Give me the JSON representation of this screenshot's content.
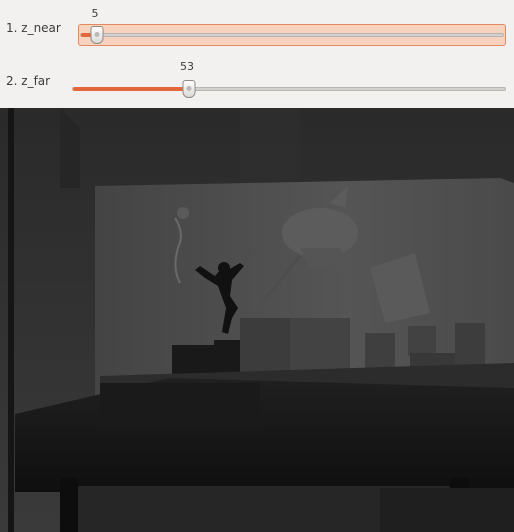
{
  "trackbars": [
    {
      "label": "1. z_near",
      "value": "5",
      "fraction": 0.04
    },
    {
      "label": "2. z_far",
      "value": "53",
      "fraction": 0.27
    }
  ],
  "depth_image": {
    "palette": [
      "#1a1a1a",
      "#262626",
      "#2f2f2f",
      "#3a3a3a",
      "#474747",
      "#555555",
      "#0a0a0a"
    ]
  }
}
